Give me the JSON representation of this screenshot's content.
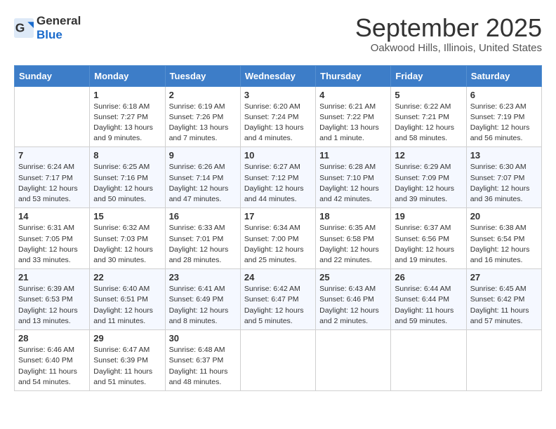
{
  "logo": {
    "general": "General",
    "blue": "Blue"
  },
  "header": {
    "month": "September 2025",
    "location": "Oakwood Hills, Illinois, United States"
  },
  "weekdays": [
    "Sunday",
    "Monday",
    "Tuesday",
    "Wednesday",
    "Thursday",
    "Friday",
    "Saturday"
  ],
  "weeks": [
    [
      {
        "day": "",
        "lines": []
      },
      {
        "day": "1",
        "lines": [
          "Sunrise: 6:18 AM",
          "Sunset: 7:27 PM",
          "Daylight: 13 hours",
          "and 9 minutes."
        ]
      },
      {
        "day": "2",
        "lines": [
          "Sunrise: 6:19 AM",
          "Sunset: 7:26 PM",
          "Daylight: 13 hours",
          "and 7 minutes."
        ]
      },
      {
        "day": "3",
        "lines": [
          "Sunrise: 6:20 AM",
          "Sunset: 7:24 PM",
          "Daylight: 13 hours",
          "and 4 minutes."
        ]
      },
      {
        "day": "4",
        "lines": [
          "Sunrise: 6:21 AM",
          "Sunset: 7:22 PM",
          "Daylight: 13 hours",
          "and 1 minute."
        ]
      },
      {
        "day": "5",
        "lines": [
          "Sunrise: 6:22 AM",
          "Sunset: 7:21 PM",
          "Daylight: 12 hours",
          "and 58 minutes."
        ]
      },
      {
        "day": "6",
        "lines": [
          "Sunrise: 6:23 AM",
          "Sunset: 7:19 PM",
          "Daylight: 12 hours",
          "and 56 minutes."
        ]
      }
    ],
    [
      {
        "day": "7",
        "lines": [
          "Sunrise: 6:24 AM",
          "Sunset: 7:17 PM",
          "Daylight: 12 hours",
          "and 53 minutes."
        ]
      },
      {
        "day": "8",
        "lines": [
          "Sunrise: 6:25 AM",
          "Sunset: 7:16 PM",
          "Daylight: 12 hours",
          "and 50 minutes."
        ]
      },
      {
        "day": "9",
        "lines": [
          "Sunrise: 6:26 AM",
          "Sunset: 7:14 PM",
          "Daylight: 12 hours",
          "and 47 minutes."
        ]
      },
      {
        "day": "10",
        "lines": [
          "Sunrise: 6:27 AM",
          "Sunset: 7:12 PM",
          "Daylight: 12 hours",
          "and 44 minutes."
        ]
      },
      {
        "day": "11",
        "lines": [
          "Sunrise: 6:28 AM",
          "Sunset: 7:10 PM",
          "Daylight: 12 hours",
          "and 42 minutes."
        ]
      },
      {
        "day": "12",
        "lines": [
          "Sunrise: 6:29 AM",
          "Sunset: 7:09 PM",
          "Daylight: 12 hours",
          "and 39 minutes."
        ]
      },
      {
        "day": "13",
        "lines": [
          "Sunrise: 6:30 AM",
          "Sunset: 7:07 PM",
          "Daylight: 12 hours",
          "and 36 minutes."
        ]
      }
    ],
    [
      {
        "day": "14",
        "lines": [
          "Sunrise: 6:31 AM",
          "Sunset: 7:05 PM",
          "Daylight: 12 hours",
          "and 33 minutes."
        ]
      },
      {
        "day": "15",
        "lines": [
          "Sunrise: 6:32 AM",
          "Sunset: 7:03 PM",
          "Daylight: 12 hours",
          "and 30 minutes."
        ]
      },
      {
        "day": "16",
        "lines": [
          "Sunrise: 6:33 AM",
          "Sunset: 7:01 PM",
          "Daylight: 12 hours",
          "and 28 minutes."
        ]
      },
      {
        "day": "17",
        "lines": [
          "Sunrise: 6:34 AM",
          "Sunset: 7:00 PM",
          "Daylight: 12 hours",
          "and 25 minutes."
        ]
      },
      {
        "day": "18",
        "lines": [
          "Sunrise: 6:35 AM",
          "Sunset: 6:58 PM",
          "Daylight: 12 hours",
          "and 22 minutes."
        ]
      },
      {
        "day": "19",
        "lines": [
          "Sunrise: 6:37 AM",
          "Sunset: 6:56 PM",
          "Daylight: 12 hours",
          "and 19 minutes."
        ]
      },
      {
        "day": "20",
        "lines": [
          "Sunrise: 6:38 AM",
          "Sunset: 6:54 PM",
          "Daylight: 12 hours",
          "and 16 minutes."
        ]
      }
    ],
    [
      {
        "day": "21",
        "lines": [
          "Sunrise: 6:39 AM",
          "Sunset: 6:53 PM",
          "Daylight: 12 hours",
          "and 13 minutes."
        ]
      },
      {
        "day": "22",
        "lines": [
          "Sunrise: 6:40 AM",
          "Sunset: 6:51 PM",
          "Daylight: 12 hours",
          "and 11 minutes."
        ]
      },
      {
        "day": "23",
        "lines": [
          "Sunrise: 6:41 AM",
          "Sunset: 6:49 PM",
          "Daylight: 12 hours",
          "and 8 minutes."
        ]
      },
      {
        "day": "24",
        "lines": [
          "Sunrise: 6:42 AM",
          "Sunset: 6:47 PM",
          "Daylight: 12 hours",
          "and 5 minutes."
        ]
      },
      {
        "day": "25",
        "lines": [
          "Sunrise: 6:43 AM",
          "Sunset: 6:46 PM",
          "Daylight: 12 hours",
          "and 2 minutes."
        ]
      },
      {
        "day": "26",
        "lines": [
          "Sunrise: 6:44 AM",
          "Sunset: 6:44 PM",
          "Daylight: 11 hours",
          "and 59 minutes."
        ]
      },
      {
        "day": "27",
        "lines": [
          "Sunrise: 6:45 AM",
          "Sunset: 6:42 PM",
          "Daylight: 11 hours",
          "and 57 minutes."
        ]
      }
    ],
    [
      {
        "day": "28",
        "lines": [
          "Sunrise: 6:46 AM",
          "Sunset: 6:40 PM",
          "Daylight: 11 hours",
          "and 54 minutes."
        ]
      },
      {
        "day": "29",
        "lines": [
          "Sunrise: 6:47 AM",
          "Sunset: 6:39 PM",
          "Daylight: 11 hours",
          "and 51 minutes."
        ]
      },
      {
        "day": "30",
        "lines": [
          "Sunrise: 6:48 AM",
          "Sunset: 6:37 PM",
          "Daylight: 11 hours",
          "and 48 minutes."
        ]
      },
      {
        "day": "",
        "lines": []
      },
      {
        "day": "",
        "lines": []
      },
      {
        "day": "",
        "lines": []
      },
      {
        "day": "",
        "lines": []
      }
    ]
  ]
}
